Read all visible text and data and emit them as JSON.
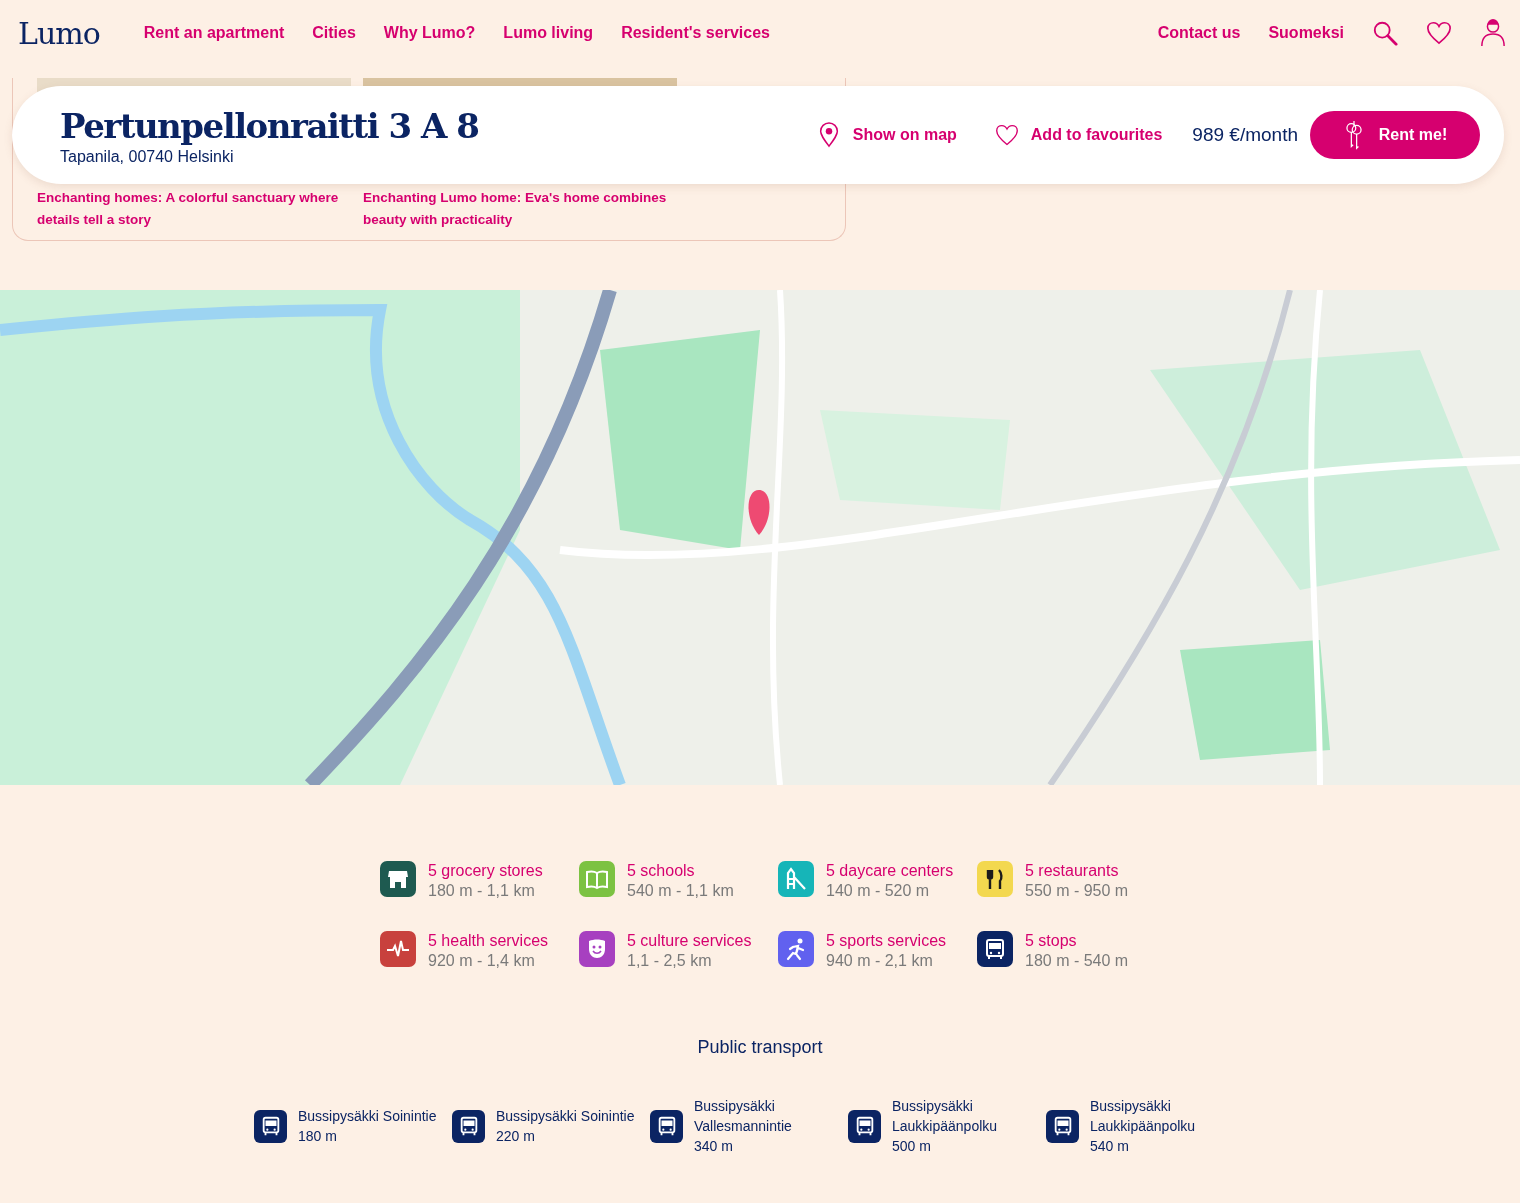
{
  "header": {
    "logo": "Lumo",
    "nav": [
      "Rent an apartment",
      "Cities",
      "Why Lumo?",
      "Lumo living",
      "Resident's services"
    ],
    "links": [
      "Contact us",
      "Suomeksi"
    ]
  },
  "articles": [
    {
      "kind": "picture",
      "title": "Enchanting homes: A colorful sanctuary where details tell a story"
    },
    {
      "kind": "picture",
      "title": "Enchanting Lumo home: Eva's home combines beauty with practicality"
    }
  ],
  "listing": {
    "address": "Pertunpellonraitti 3 A 8",
    "area": "Tapanila, 00740 Helsinki",
    "show_on_map": "Show on map",
    "favourite": "Add to favourites",
    "price": "989 €/month",
    "rent": "Rent me!"
  },
  "services": [
    {
      "kind": "grocery",
      "color": "#1e5a50",
      "title": "5 grocery stores",
      "range": "180 m - 1,1 km"
    },
    {
      "kind": "school",
      "color": "#7cc242",
      "title": "5 schools",
      "range": "540 m - 1,1 km"
    },
    {
      "kind": "daycare",
      "color": "#16b5b8",
      "title": "5 daycare centers",
      "range": "140 m - 520 m"
    },
    {
      "kind": "restaurant",
      "color": "#f3d84f",
      "title": "5 restaurants",
      "range": "550 m - 950 m"
    },
    {
      "kind": "health",
      "color": "#c8413d",
      "title": "5 health services",
      "range": "920 m - 1,4 km"
    },
    {
      "kind": "culture",
      "color": "#a740c0",
      "title": "5 culture services",
      "range": "1,1 - 2,5 km"
    },
    {
      "kind": "sports",
      "color": "#6161ef",
      "title": "5 sports services",
      "range": "940 m - 2,1 km"
    },
    {
      "kind": "stops",
      "color": "#0b2463",
      "title": "5 stops",
      "range": "180 m - 540 m"
    }
  ],
  "transport": {
    "title": "Public transport",
    "stops": [
      {
        "name": "Bussipysäkki Soinintie",
        "distance": "180 m"
      },
      {
        "name": "Bussipysäkki Soinintie",
        "distance": "220 m"
      },
      {
        "name": "Bussipysäkki Vallesmannintie",
        "distance": "340 m"
      },
      {
        "name": "Bussipysäkki Laukkipäänpolku",
        "distance": "500 m"
      },
      {
        "name": "Bussipysäkki Laukkipäänpolku",
        "distance": "540 m"
      }
    ]
  }
}
